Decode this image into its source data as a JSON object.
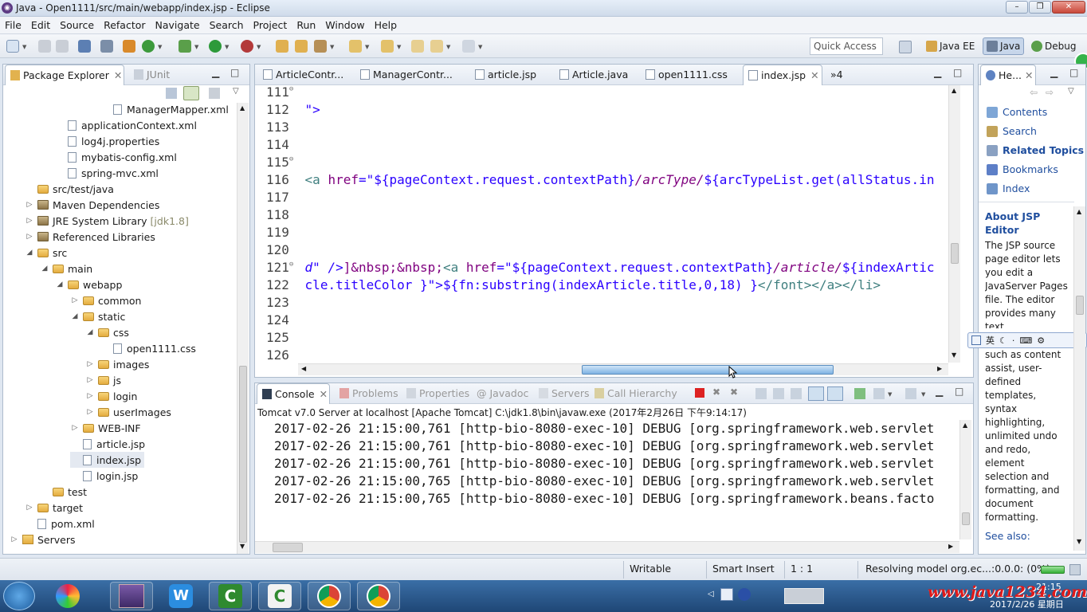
{
  "window": {
    "title": "Java - Open1111/src/main/webapp/index.jsp - Eclipse",
    "controls": [
      "–",
      "❐",
      "✕"
    ]
  },
  "menu": [
    "File",
    "Edit",
    "Source",
    "Refactor",
    "Navigate",
    "Search",
    "Project",
    "Run",
    "Window",
    "Help"
  ],
  "toolbar": {
    "quick_access": "Quick Access",
    "perspectives": [
      {
        "label": "Java EE",
        "active": false
      },
      {
        "label": "Java",
        "active": true
      },
      {
        "label": "Debug",
        "active": false
      }
    ]
  },
  "package_explorer": {
    "tabs": [
      "Package Explorer",
      "JUnit"
    ],
    "tree": [
      {
        "label": "ManagerMapper.xml",
        "kind": "xml",
        "depth": 6,
        "twisty": ""
      },
      {
        "label": "applicationContext.xml",
        "kind": "xml",
        "depth": 3,
        "twisty": ""
      },
      {
        "label": "log4j.properties",
        "kind": "xml",
        "depth": 3,
        "twisty": ""
      },
      {
        "label": "mybatis-config.xml",
        "kind": "xml",
        "depth": 3,
        "twisty": ""
      },
      {
        "label": "spring-mvc.xml",
        "kind": "xml",
        "depth": 3,
        "twisty": ""
      },
      {
        "label": "src/test/java",
        "kind": "srcfolder",
        "depth": 1,
        "twisty": ""
      },
      {
        "label": "Maven Dependencies",
        "kind": "lib",
        "depth": 1,
        "twisty": "▷"
      },
      {
        "label": "JRE System Library",
        "suffix": "[jdk1.8]",
        "kind": "lib",
        "depth": 1,
        "twisty": "▷"
      },
      {
        "label": "Referenced Libraries",
        "kind": "lib",
        "depth": 1,
        "twisty": "▷"
      },
      {
        "label": "src",
        "kind": "folder",
        "depth": 1,
        "twisty": "◢"
      },
      {
        "label": "main",
        "kind": "folder",
        "depth": 2,
        "twisty": "◢"
      },
      {
        "label": "webapp",
        "kind": "folder",
        "depth": 3,
        "twisty": "◢"
      },
      {
        "label": "common",
        "kind": "folder",
        "depth": 4,
        "twisty": "▷"
      },
      {
        "label": "static",
        "kind": "folder",
        "depth": 4,
        "twisty": "◢"
      },
      {
        "label": "css",
        "kind": "folder",
        "depth": 5,
        "twisty": "◢"
      },
      {
        "label": "open1111.css",
        "kind": "file",
        "depth": 6,
        "twisty": ""
      },
      {
        "label": "images",
        "kind": "folder",
        "depth": 5,
        "twisty": "▷"
      },
      {
        "label": "js",
        "kind": "folder",
        "depth": 5,
        "twisty": "▷"
      },
      {
        "label": "login",
        "kind": "folder",
        "depth": 5,
        "twisty": "▷"
      },
      {
        "label": "userImages",
        "kind": "folder",
        "depth": 5,
        "twisty": "▷"
      },
      {
        "label": "WEB-INF",
        "kind": "folder",
        "depth": 4,
        "twisty": "▷"
      },
      {
        "label": "article.jsp",
        "kind": "jsp",
        "depth": 4,
        "twisty": ""
      },
      {
        "label": "index.jsp",
        "kind": "jsp",
        "depth": 4,
        "twisty": "",
        "selected": true
      },
      {
        "label": "login.jsp",
        "kind": "jsp",
        "depth": 4,
        "twisty": ""
      },
      {
        "label": "test",
        "kind": "folder",
        "depth": 2,
        "twisty": ""
      },
      {
        "label": "target",
        "kind": "folder",
        "depth": 1,
        "twisty": "▷"
      },
      {
        "label": "pom.xml",
        "kind": "xml",
        "depth": 1,
        "twisty": ""
      },
      {
        "label": "Servers",
        "kind": "projfolder",
        "depth": 0,
        "twisty": "▷"
      }
    ]
  },
  "editor": {
    "tabs": [
      "ArticleContr...",
      "ManagerContr...",
      "article.jsp",
      "Article.java",
      "open1111.css",
      "index.jsp"
    ],
    "active_tab": "index.jsp",
    "overflow": "»4",
    "lines": [
      {
        "n": "111",
        "fold": "⊖",
        "segments": []
      },
      {
        "n": "112",
        "fold": "",
        "segments": [
          {
            "t": "\">",
            "c": "str"
          }
        ]
      },
      {
        "n": "113",
        "fold": "",
        "segments": []
      },
      {
        "n": "114",
        "fold": "",
        "segments": []
      },
      {
        "n": "115",
        "fold": "⊖",
        "segments": []
      },
      {
        "n": "116",
        "fold": "",
        "segments": [
          {
            "t": "<a ",
            "c": "kw"
          },
          {
            "t": "href",
            "c": "attr"
          },
          {
            "t": "=\"${pageContext.request.contextPath}",
            "c": "str"
          },
          {
            "t": "/arcType/",
            "c": "attr-i"
          },
          {
            "t": "${arcTypeList.get(allStatus.in",
            "c": "str"
          }
        ]
      },
      {
        "n": "117",
        "fold": "",
        "segments": []
      },
      {
        "n": "118",
        "fold": "",
        "segments": []
      },
      {
        "n": "119",
        "fold": "",
        "segments": []
      },
      {
        "n": "120",
        "fold": "",
        "segments": []
      },
      {
        "n": "121",
        "fold": "⊖",
        "segments": [
          {
            "t": "d\" />",
            "c": "str-i"
          },
          {
            "t": "]&nbsp;&nbsp;",
            "c": "attr"
          },
          {
            "t": "<a ",
            "c": "kw"
          },
          {
            "t": "href",
            "c": "attr"
          },
          {
            "t": "=\"${pageContext.request.contextPath}",
            "c": "str"
          },
          {
            "t": "/article/",
            "c": "attr-i"
          },
          {
            "t": "${indexArtic",
            "c": "str"
          }
        ]
      },
      {
        "n": "122",
        "fold": "",
        "segments": [
          {
            "t": "cle.titleColor }\">${fn:substring(indexArticle.title,0,18) }",
            "c": "str"
          },
          {
            "t": "</font></a></li>",
            "c": "kw"
          }
        ]
      },
      {
        "n": "123",
        "fold": "",
        "segments": []
      },
      {
        "n": "124",
        "fold": "",
        "segments": []
      },
      {
        "n": "125",
        "fold": "",
        "segments": []
      },
      {
        "n": "126",
        "fold": "",
        "segments": []
      }
    ]
  },
  "console": {
    "tabs": [
      "Console",
      "Problems",
      "Properties",
      "Javadoc",
      "Servers",
      "Call Hierarchy"
    ],
    "header": "Tomcat v7.0 Server at localhost [Apache Tomcat] C:\\jdk1.8\\bin\\javaw.exe (2017年2月26日 下午9:14:17)",
    "lines": [
      "2017-02-26 21:15:00,761 [http-bio-8080-exec-10] DEBUG [org.springframework.web.servlet",
      "2017-02-26 21:15:00,761 [http-bio-8080-exec-10] DEBUG [org.springframework.web.servlet",
      "2017-02-26 21:15:00,761 [http-bio-8080-exec-10] DEBUG [org.springframework.web.servlet",
      "2017-02-26 21:15:00,765 [http-bio-8080-exec-10] DEBUG [org.springframework.web.servlet",
      "2017-02-26 21:15:00,765 [http-bio-8080-exec-10] DEBUG [org.springframework.beans.facto"
    ]
  },
  "help": {
    "tab": "He...",
    "links": [
      {
        "label": "Contents",
        "bold": false
      },
      {
        "label": "Search",
        "bold": false
      },
      {
        "label": "Related Topics",
        "bold": true
      },
      {
        "label": "Bookmarks",
        "bold": false
      },
      {
        "label": "Index",
        "bold": false
      }
    ],
    "about_title": "About JSP Editor",
    "about_text_top": "The JSP source page editor lets you edit a JavaServer Pages file. The editor provides many text",
    "about_text_bottom": "such as content assist, user-defined templates, syntax highlighting, unlimited undo and redo, element selection and formatting, and document formatting.",
    "see_also": "See also:",
    "ime_label": "英"
  },
  "status": {
    "writable": "Writable",
    "insert_mode": "Smart Insert",
    "position": "1 : 1",
    "progress": "Resolving model org.ec...:0.0.0: (0%)"
  },
  "taskbar": {
    "tray_time": "21:15",
    "tray_date": "2017/2/26 星期日",
    "watermark": "www.java1234.com"
  }
}
